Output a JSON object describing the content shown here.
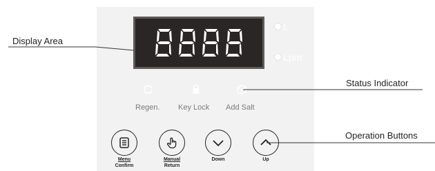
{
  "display": {
    "digits": [
      "8",
      "8",
      "8",
      "8"
    ],
    "indicators": [
      {
        "label": "L"
      },
      {
        "label": "Lpm"
      }
    ]
  },
  "status": [
    {
      "label": "Regen.",
      "icon": "regen-icon"
    },
    {
      "label": "Key Lock",
      "icon": "lock-icon"
    },
    {
      "label": "Add Salt",
      "icon": "salt-icon"
    }
  ],
  "buttons": [
    {
      "top": "Menu",
      "bottom": "Confirm",
      "icon": "menu-icon"
    },
    {
      "top": "Manual",
      "bottom": "Return",
      "icon": "hand-icon"
    },
    {
      "top": "Down",
      "bottom": "",
      "icon": "chevron-down-icon"
    },
    {
      "top": "Up",
      "bottom": "",
      "icon": "chevron-up-icon"
    }
  ],
  "callouts": {
    "display_area": "Display Area",
    "status_indicator": "Status Indicator",
    "operation_buttons": "Operation Buttons"
  },
  "colors": {
    "panel": "#f1f2f1",
    "display_bg": "#2b2626",
    "display_border": "#5d5957",
    "segment": "#ffffff",
    "status_gray": "#7b7b7b"
  }
}
